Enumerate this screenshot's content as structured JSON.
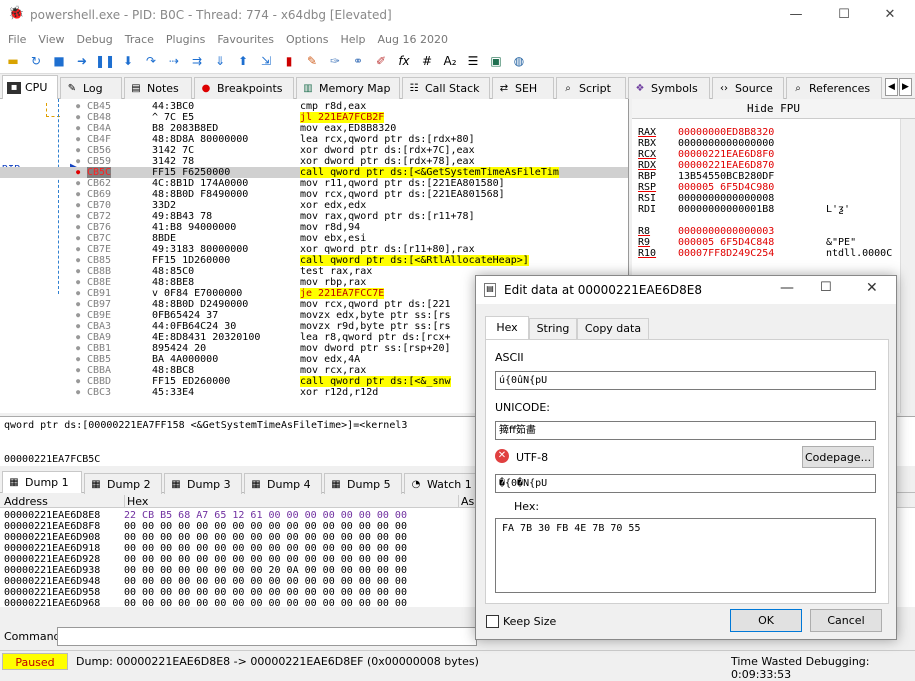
{
  "window": {
    "title": "powershell.exe - PID: B0C - Thread: 774 - x64dbg [Elevated]",
    "minimize": "—",
    "maximize": "☐",
    "close": "✕"
  },
  "menu": [
    "File",
    "View",
    "Debug",
    "Trace",
    "Plugins",
    "Favourites",
    "Options",
    "Help",
    "Aug 16 2020"
  ],
  "toolbar_icons": [
    "open-icon",
    "restart-icon",
    "stop-icon",
    "run-icon",
    "pause-icon",
    "step-into-icon",
    "step-over-icon",
    "trace-into-icon",
    "trace-over-icon",
    "execute-till-return-icon",
    "run-to-user-icon",
    "memory-icon",
    "patch-icon",
    "breakpoint-icon",
    "script-icon",
    "fx-icon",
    "hash-icon",
    "font-icon",
    "list-icon",
    "plugin-icon",
    "globe-icon"
  ],
  "tabs": [
    "CPU",
    "Log",
    "Notes",
    "Breakpoints",
    "Memory Map",
    "Call Stack",
    "SEH",
    "Script",
    "Symbols",
    "Source",
    "References"
  ],
  "disasm": [
    {
      "addr": "CB45",
      "bytes": "44:3BC0",
      "instr": "cmp r8d,eax",
      "hl": ""
    },
    {
      "addr": "CB48",
      "bytes": "^ 7C E5",
      "instr": "jl 221EA7FCB2F",
      "hl": "jmp"
    },
    {
      "addr": "CB4A",
      "bytes": "B8 2083B8ED",
      "instr": "mov eax,ED8B8320",
      "hl": ""
    },
    {
      "addr": "CB4F",
      "bytes": "48:8D8A 80000000",
      "instr": "lea rcx,qword ptr ds:[rdx+80]",
      "hl": ""
    },
    {
      "addr": "CB56",
      "bytes": "3142 7C",
      "instr": "xor dword ptr ds:[rdx+7C],eax",
      "hl": ""
    },
    {
      "addr": "CB59",
      "bytes": "3142 78",
      "instr": "xor dword ptr ds:[rdx+78],eax",
      "hl": ""
    },
    {
      "addr": "CB5C",
      "bytes": "FF15 F6250000",
      "instr": "call qword ptr ds:[<&GetSystemTimeAsFileTim",
      "hl": "rip"
    },
    {
      "addr": "CB62",
      "bytes": "4C:8B1D 174A0000",
      "instr": "mov r11,qword ptr ds:[221EA801580]",
      "hl": ""
    },
    {
      "addr": "CB69",
      "bytes": "48:8B0D F8490000",
      "instr": "mov rcx,qword ptr ds:[221EA801568]",
      "hl": ""
    },
    {
      "addr": "CB70",
      "bytes": "33D2",
      "instr": "xor edx,edx",
      "hl": ""
    },
    {
      "addr": "CB72",
      "bytes": "49:8B43 78",
      "instr": "mov rax,qword ptr ds:[r11+78]",
      "hl": ""
    },
    {
      "addr": "CB76",
      "bytes": "41:B8 94000000",
      "instr": "mov r8d,94",
      "hl": ""
    },
    {
      "addr": "CB7C",
      "bytes": "8BDE",
      "instr": "mov ebx,esi",
      "hl": ""
    },
    {
      "addr": "CB7E",
      "bytes": "49:3183 80000000",
      "instr": "xor qword ptr ds:[r11+80],rax",
      "hl": ""
    },
    {
      "addr": "CB85",
      "bytes": "FF15 1D260000",
      "instr": "call qword ptr ds:[<&RtlAllocateHeap>]",
      "hl": "call"
    },
    {
      "addr": "CB8B",
      "bytes": "48:85C0",
      "instr": "test rax,rax",
      "hl": ""
    },
    {
      "addr": "CB8E",
      "bytes": "48:8BE8",
      "instr": "mov rbp,rax",
      "hl": ""
    },
    {
      "addr": "CB91",
      "bytes": "v 0F84 E7000000",
      "instr": "je 221EA7FCC7E",
      "hl": "jmp"
    },
    {
      "addr": "CB97",
      "bytes": "48:8B0D D2490000",
      "instr": "mov rcx,qword ptr ds:[221",
      "hl": ""
    },
    {
      "addr": "CB9E",
      "bytes": "0FB65424 37",
      "instr": "movzx edx,byte ptr ss:[rs",
      "hl": ""
    },
    {
      "addr": "CBA3",
      "bytes": "44:0FB64C24 30",
      "instr": "movzx r9d,byte ptr ss:[rs",
      "hl": ""
    },
    {
      "addr": "CBA9",
      "bytes": "4E:8D8431 20320100",
      "instr": "lea r8,qword ptr ds:[rcx+",
      "hl": ""
    },
    {
      "addr": "CBB1",
      "bytes": "895424 20",
      "instr": "mov dword ptr ss:[rsp+20]",
      "hl": ""
    },
    {
      "addr": "CBB5",
      "bytes": "BA 4A000000",
      "instr": "mov edx,4A",
      "hl": ""
    },
    {
      "addr": "CBBA",
      "bytes": "48:8BC8",
      "instr": "mov rcx,rax",
      "hl": ""
    },
    {
      "addr": "CBBD",
      "bytes": "FF15 ED260000",
      "instr": "call qword ptr ds:[<&_snw",
      "hl": "call"
    },
    {
      "addr": "CBC3",
      "bytes": "45:33E4",
      "instr": "xor r12d,r12d",
      "hl": ""
    }
  ],
  "rip_label": "RIP",
  "fpu": {
    "header": "Hide FPU",
    "regs": [
      {
        "n": "RAX",
        "v": "00000000ED8B8320",
        "c": "",
        "red": true
      },
      {
        "n": "RBX",
        "v": "0000000000000000",
        "c": "",
        "red": false
      },
      {
        "n": "RCX",
        "v": "00000221EAE6D8F0",
        "c": "",
        "red": true
      },
      {
        "n": "RDX",
        "v": "00000221EAE6D870",
        "c": "",
        "red": true
      },
      {
        "n": "RBP",
        "v": "13B54550BCB280DF",
        "c": "",
        "red": false
      },
      {
        "n": "RSP",
        "v": "000005 6F5D4C980",
        "c": "",
        "red": true
      },
      {
        "n": "RSI",
        "v": "0000000000000008",
        "c": "",
        "red": false
      },
      {
        "n": "RDI",
        "v": "00000000000001B8",
        "c": "L'ƺ'",
        "red": false
      },
      {
        "n": "",
        "v": "",
        "c": "",
        "red": false
      },
      {
        "n": "R8",
        "v": "0000000000000003",
        "c": "",
        "red": true
      },
      {
        "n": "R9",
        "v": "000005 6F5D4C848",
        "c": "&\"PE\"",
        "red": true
      },
      {
        "n": "R10",
        "v": "00007FF8D249C254",
        "c": "ntdll.0000C",
        "red": true
      }
    ]
  },
  "info": {
    "line1": "qword ptr ds:[00000221EA7FF158 <&GetSystemTimeAsFileTime>]=<kernel3",
    "line2": "00000221EA7FCB5C"
  },
  "dumptabs": [
    "Dump 1",
    "Dump 2",
    "Dump 3",
    "Dump 4",
    "Dump 5",
    "Watch 1"
  ],
  "dump": {
    "headers": [
      "Address",
      "Hex",
      "As"
    ],
    "rows": [
      {
        "a": "00000221EAE6D8E8",
        "h": "22 CB B5 68 A7 65 12 61 00 00 00 00 00 00 00 00"
      },
      {
        "a": "00000221EAE6D8F8",
        "h": "00 00 00 00 00 00 00 00 00 00 00 00 00 00 00 00"
      },
      {
        "a": "00000221EAE6D908",
        "h": "00 00 00 00 00 00 00 00 00 00 00 00 00 00 00 00"
      },
      {
        "a": "00000221EAE6D918",
        "h": "00 00 00 00 00 00 00 00 00 00 00 00 00 00 00 00"
      },
      {
        "a": "00000221EAE6D928",
        "h": "00 00 00 00 00 00 00 00 00 00 00 00 00 00 00 00"
      },
      {
        "a": "00000221EAE6D938",
        "h": "00 00 00 00 00 00 00 00 20 0A 00 00 00 00 00 00"
      },
      {
        "a": "00000221EAE6D948",
        "h": "00 00 00 00 00 00 00 00 00 00 00 00 00 00 00 00"
      },
      {
        "a": "00000221EAE6D958",
        "h": "00 00 00 00 00 00 00 00 00 00 00 00 00 00 00 00"
      },
      {
        "a": "00000221EAE6D968",
        "h": "00 00 00 00 00 00 00 00 00 00 00 00 00 00 00 00"
      }
    ]
  },
  "command": {
    "label": "Command:",
    "placeholder": ""
  },
  "status": {
    "state": "Paused",
    "dump": "Dump: 00000221EAE6D8E8 -> 00000221EAE6D8EF (0x00000008 bytes)",
    "time": "Time Wasted Debugging: 0:09:33:53"
  },
  "dialog": {
    "title": "Edit data at 00000221EAE6D8E8",
    "tabs": [
      "Hex",
      "String",
      "Copy data"
    ],
    "ascii_label": "ASCII",
    "ascii": "ú{0ûN{pU",
    "unicode_label": "UNICODE:",
    "unicode": "篺ﬀ筎畵",
    "utf8_label": "UTF-8",
    "utf8": "�{0�N{pU",
    "codepage": "Codepage...",
    "hex_label": "Hex:",
    "hex": "FA 7B 30 FB 4E 7B 70 55",
    "keepsize": "Keep Size",
    "ok": "OK",
    "cancel": "Cancel"
  },
  "colors": {
    "rip_bg": "#808080",
    "yellow": "#ffff00",
    "cyan": "#00ffff",
    "reg_red": "#ff0000",
    "status_paused": "#ffff00"
  }
}
